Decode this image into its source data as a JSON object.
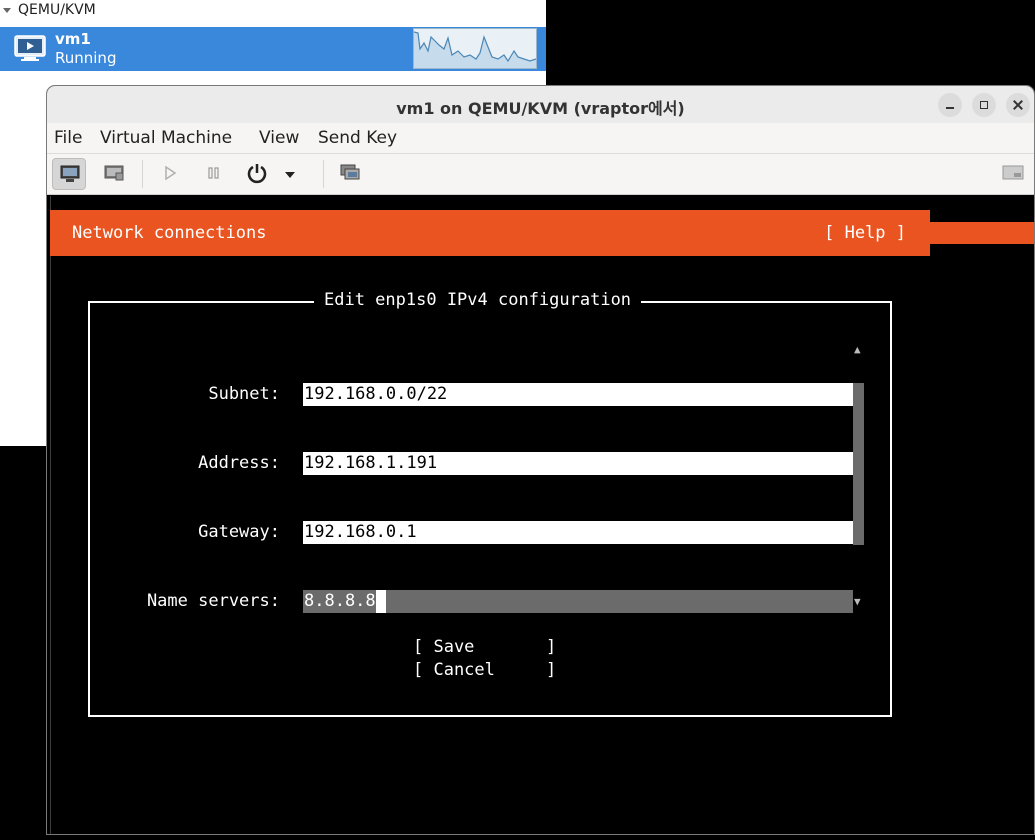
{
  "manager": {
    "connection_label": "QEMU/KVM",
    "vm_name": "vm1",
    "vm_status": "Running"
  },
  "console": {
    "window_title": "vm1 on QEMU/KVM (vraptor에서)",
    "menu": {
      "file": "File",
      "virtual_machine": "Virtual Machine",
      "view": "View",
      "send_key": "Send Key"
    },
    "toolbar_icons": [
      "monitor-icon",
      "details-icon",
      "play-icon",
      "pause-icon",
      "power-icon",
      "dropdown-arrow-icon",
      "snapshots-icon",
      "fullscreen-icon"
    ]
  },
  "installer": {
    "header_title": "Network connections",
    "header_help": "[ Help ]",
    "dialog_title": "Edit enp1s0 IPv4 configuration",
    "fields": {
      "subnet_label": "Subnet:",
      "subnet_value": "192.168.0.0/22",
      "address_label": "Address:",
      "address_value": "192.168.1.191",
      "gateway_label": "Gateway:",
      "gateway_value": "192.168.0.1",
      "nameservers_label": "Name servers:",
      "nameservers_value": "8.8.8.8"
    },
    "buttons": {
      "save": "[ Save       ]",
      "cancel": "[ Cancel     ]"
    },
    "scroll_up_glyph": "▲",
    "scroll_down_glyph": "▼"
  },
  "colors": {
    "accent_orange": "#e95420",
    "selection_blue": "#3a88dc"
  }
}
